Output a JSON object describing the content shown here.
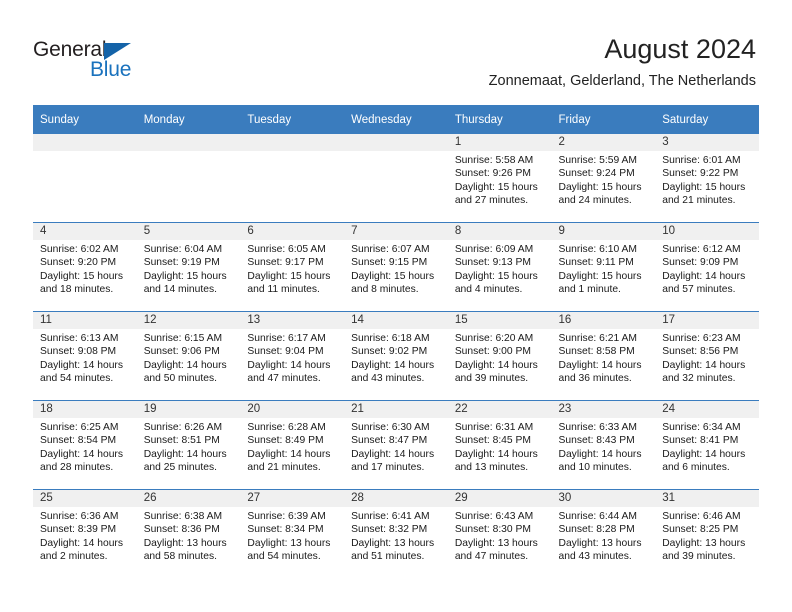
{
  "logo": {
    "text_top": "General",
    "text_bottom": "Blue",
    "triangle_icon": "triangle-icon",
    "color_dark": "#231f20",
    "color_blue": "#1a72bd"
  },
  "header": {
    "title": "August 2024",
    "subtitle": "Zonnemaat, Gelderland, The Netherlands"
  },
  "theme": {
    "header_bg": "#3a7cbe",
    "daynum_bg": "#f0f0f0",
    "grid_line": "#3a7cbe"
  },
  "calendar": {
    "weekday_headers": [
      "Sunday",
      "Monday",
      "Tuesday",
      "Wednesday",
      "Thursday",
      "Friday",
      "Saturday"
    ],
    "weeks": [
      [
        {
          "day": "",
          "lines": []
        },
        {
          "day": "",
          "lines": []
        },
        {
          "day": "",
          "lines": []
        },
        {
          "day": "",
          "lines": []
        },
        {
          "day": "1",
          "lines": [
            "Sunrise: 5:58 AM",
            "Sunset: 9:26 PM",
            "Daylight: 15 hours",
            "and 27 minutes."
          ]
        },
        {
          "day": "2",
          "lines": [
            "Sunrise: 5:59 AM",
            "Sunset: 9:24 PM",
            "Daylight: 15 hours",
            "and 24 minutes."
          ]
        },
        {
          "day": "3",
          "lines": [
            "Sunrise: 6:01 AM",
            "Sunset: 9:22 PM",
            "Daylight: 15 hours",
            "and 21 minutes."
          ]
        }
      ],
      [
        {
          "day": "4",
          "lines": [
            "Sunrise: 6:02 AM",
            "Sunset: 9:20 PM",
            "Daylight: 15 hours",
            "and 18 minutes."
          ]
        },
        {
          "day": "5",
          "lines": [
            "Sunrise: 6:04 AM",
            "Sunset: 9:19 PM",
            "Daylight: 15 hours",
            "and 14 minutes."
          ]
        },
        {
          "day": "6",
          "lines": [
            "Sunrise: 6:05 AM",
            "Sunset: 9:17 PM",
            "Daylight: 15 hours",
            "and 11 minutes."
          ]
        },
        {
          "day": "7",
          "lines": [
            "Sunrise: 6:07 AM",
            "Sunset: 9:15 PM",
            "Daylight: 15 hours",
            "and 8 minutes."
          ]
        },
        {
          "day": "8",
          "lines": [
            "Sunrise: 6:09 AM",
            "Sunset: 9:13 PM",
            "Daylight: 15 hours",
            "and 4 minutes."
          ]
        },
        {
          "day": "9",
          "lines": [
            "Sunrise: 6:10 AM",
            "Sunset: 9:11 PM",
            "Daylight: 15 hours",
            "and 1 minute."
          ]
        },
        {
          "day": "10",
          "lines": [
            "Sunrise: 6:12 AM",
            "Sunset: 9:09 PM",
            "Daylight: 14 hours",
            "and 57 minutes."
          ]
        }
      ],
      [
        {
          "day": "11",
          "lines": [
            "Sunrise: 6:13 AM",
            "Sunset: 9:08 PM",
            "Daylight: 14 hours",
            "and 54 minutes."
          ]
        },
        {
          "day": "12",
          "lines": [
            "Sunrise: 6:15 AM",
            "Sunset: 9:06 PM",
            "Daylight: 14 hours",
            "and 50 minutes."
          ]
        },
        {
          "day": "13",
          "lines": [
            "Sunrise: 6:17 AM",
            "Sunset: 9:04 PM",
            "Daylight: 14 hours",
            "and 47 minutes."
          ]
        },
        {
          "day": "14",
          "lines": [
            "Sunrise: 6:18 AM",
            "Sunset: 9:02 PM",
            "Daylight: 14 hours",
            "and 43 minutes."
          ]
        },
        {
          "day": "15",
          "lines": [
            "Sunrise: 6:20 AM",
            "Sunset: 9:00 PM",
            "Daylight: 14 hours",
            "and 39 minutes."
          ]
        },
        {
          "day": "16",
          "lines": [
            "Sunrise: 6:21 AM",
            "Sunset: 8:58 PM",
            "Daylight: 14 hours",
            "and 36 minutes."
          ]
        },
        {
          "day": "17",
          "lines": [
            "Sunrise: 6:23 AM",
            "Sunset: 8:56 PM",
            "Daylight: 14 hours",
            "and 32 minutes."
          ]
        }
      ],
      [
        {
          "day": "18",
          "lines": [
            "Sunrise: 6:25 AM",
            "Sunset: 8:54 PM",
            "Daylight: 14 hours",
            "and 28 minutes."
          ]
        },
        {
          "day": "19",
          "lines": [
            "Sunrise: 6:26 AM",
            "Sunset: 8:51 PM",
            "Daylight: 14 hours",
            "and 25 minutes."
          ]
        },
        {
          "day": "20",
          "lines": [
            "Sunrise: 6:28 AM",
            "Sunset: 8:49 PM",
            "Daylight: 14 hours",
            "and 21 minutes."
          ]
        },
        {
          "day": "21",
          "lines": [
            "Sunrise: 6:30 AM",
            "Sunset: 8:47 PM",
            "Daylight: 14 hours",
            "and 17 minutes."
          ]
        },
        {
          "day": "22",
          "lines": [
            "Sunrise: 6:31 AM",
            "Sunset: 8:45 PM",
            "Daylight: 14 hours",
            "and 13 minutes."
          ]
        },
        {
          "day": "23",
          "lines": [
            "Sunrise: 6:33 AM",
            "Sunset: 8:43 PM",
            "Daylight: 14 hours",
            "and 10 minutes."
          ]
        },
        {
          "day": "24",
          "lines": [
            "Sunrise: 6:34 AM",
            "Sunset: 8:41 PM",
            "Daylight: 14 hours",
            "and 6 minutes."
          ]
        }
      ],
      [
        {
          "day": "25",
          "lines": [
            "Sunrise: 6:36 AM",
            "Sunset: 8:39 PM",
            "Daylight: 14 hours",
            "and 2 minutes."
          ]
        },
        {
          "day": "26",
          "lines": [
            "Sunrise: 6:38 AM",
            "Sunset: 8:36 PM",
            "Daylight: 13 hours",
            "and 58 minutes."
          ]
        },
        {
          "day": "27",
          "lines": [
            "Sunrise: 6:39 AM",
            "Sunset: 8:34 PM",
            "Daylight: 13 hours",
            "and 54 minutes."
          ]
        },
        {
          "day": "28",
          "lines": [
            "Sunrise: 6:41 AM",
            "Sunset: 8:32 PM",
            "Daylight: 13 hours",
            "and 51 minutes."
          ]
        },
        {
          "day": "29",
          "lines": [
            "Sunrise: 6:43 AM",
            "Sunset: 8:30 PM",
            "Daylight: 13 hours",
            "and 47 minutes."
          ]
        },
        {
          "day": "30",
          "lines": [
            "Sunrise: 6:44 AM",
            "Sunset: 8:28 PM",
            "Daylight: 13 hours",
            "and 43 minutes."
          ]
        },
        {
          "day": "31",
          "lines": [
            "Sunrise: 6:46 AM",
            "Sunset: 8:25 PM",
            "Daylight: 13 hours",
            "and 39 minutes."
          ]
        }
      ]
    ]
  }
}
